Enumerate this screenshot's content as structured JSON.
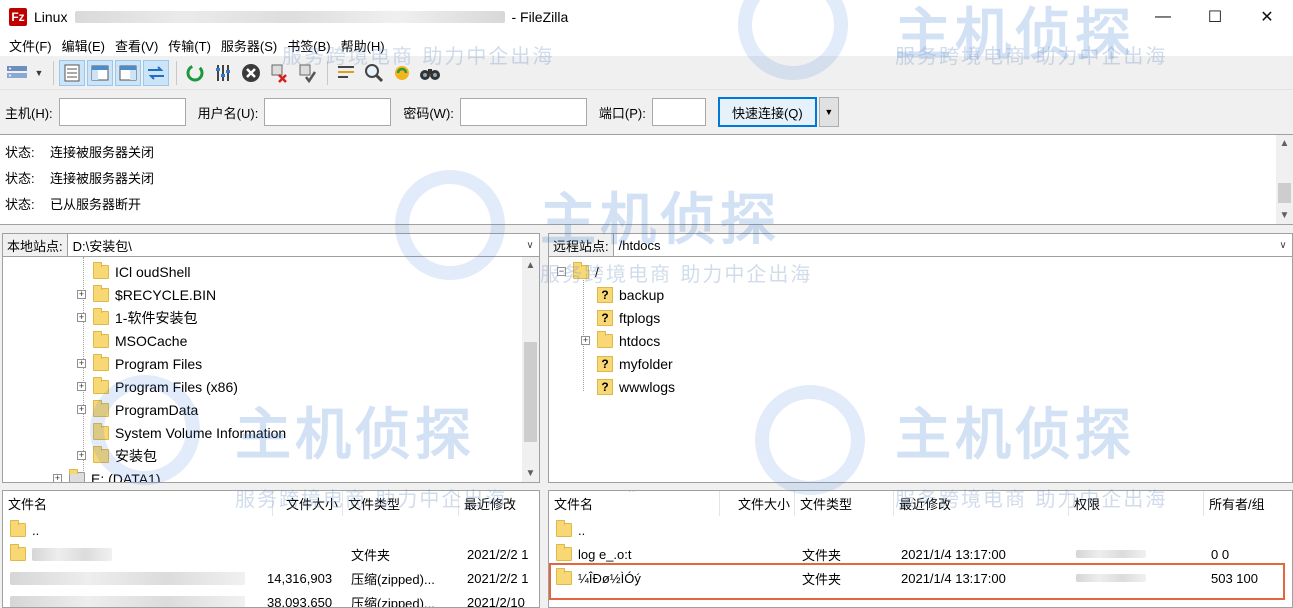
{
  "window": {
    "title_left": "Linux",
    "title_app": "- FileZilla",
    "icon_letter": "Fz",
    "minimize": "—",
    "maximize": "☐",
    "close": "✕"
  },
  "menu": [
    "文件(F)",
    "编辑(E)",
    "查看(V)",
    "传输(T)",
    "服务器(S)",
    "书签(B)",
    "帮助(H)"
  ],
  "toolbar_icons": [
    "site-manager-icon",
    "dropdown-caret-icon",
    "toggle-message-log-icon",
    "toggle-local-tree-icon",
    "toggle-remote-tree-icon",
    "toggle-transfer-queue-icon",
    "refresh-icon",
    "filter-icon",
    "cancel-icon",
    "disconnect-icon",
    "reconnect-icon",
    "directory-compare-icon",
    "search-icon",
    "sync-browse-icon",
    "find-files-icon"
  ],
  "quickconnect": {
    "host_label": "主机(H):",
    "user_label": "用户名(U):",
    "pass_label": "密码(W):",
    "port_label": "端口(P):",
    "host_value": "",
    "user_value": "",
    "pass_value": "",
    "port_value": "",
    "connect_label": "快速连接(Q)"
  },
  "log": [
    {
      "label": "状态:",
      "text": "连接被服务器关闭"
    },
    {
      "label": "状态:",
      "text": "连接被服务器关闭"
    },
    {
      "label": "状态:",
      "text": "已从服务器断开"
    }
  ],
  "local_site": {
    "label": "本地站点:",
    "path": "D:\\安装包\\"
  },
  "remote_site": {
    "label": "远程站点:",
    "path": "/htdocs"
  },
  "local_tree": [
    {
      "name": "ICl oudShell",
      "expander": ""
    },
    {
      "name": "$RECYCLE.BIN",
      "expander": "+"
    },
    {
      "name": "1-软件安装包",
      "expander": "+"
    },
    {
      "name": "MSOCache",
      "expander": ""
    },
    {
      "name": "Program Files",
      "expander": "+"
    },
    {
      "name": "Program Files (x86)",
      "expander": "+"
    },
    {
      "name": "ProgramData",
      "expander": "+"
    },
    {
      "name": "System Volume Information",
      "expander": ""
    },
    {
      "name": "安装包",
      "expander": "+"
    },
    {
      "name": "E: (DATA1)",
      "expander": "+"
    }
  ],
  "remote_tree": {
    "root": "/",
    "children": [
      {
        "name": "backup",
        "unknown": true,
        "expander": ""
      },
      {
        "name": "ftplogs",
        "unknown": true,
        "expander": ""
      },
      {
        "name": "htdocs",
        "unknown": false,
        "expander": "+"
      },
      {
        "name": "myfolder",
        "unknown": true,
        "expander": ""
      },
      {
        "name": "wwwlogs",
        "unknown": true,
        "expander": ""
      }
    ]
  },
  "local_files": {
    "headers": [
      "文件名",
      "文件大小",
      "文件类型",
      "最近修改"
    ],
    "rows": [
      {
        "name": "..",
        "size": "",
        "type": "",
        "modified": ""
      },
      {
        "name": "",
        "size": "",
        "type": "文件夹",
        "modified": "2021/2/2 1"
      },
      {
        "name": "",
        "size": "14,316,903",
        "type": "压缩(zipped)...",
        "modified": "2021/2/2 1"
      },
      {
        "name": "",
        "size": "38,093,650",
        "type": "压缩(zipped)...",
        "modified": "2021/2/10"
      }
    ]
  },
  "remote_files": {
    "headers": [
      "文件名",
      "文件大小",
      "文件类型",
      "最近修改",
      "权限",
      "所有者/组"
    ],
    "rows": [
      {
        "name": "..",
        "size": "",
        "type": "",
        "modified": "",
        "perms": "",
        "owner": ""
      },
      {
        "name": "log e_.o:t",
        "size": "",
        "type": "文件夹",
        "modified": "2021/1/4 13:17:00",
        "perms": "",
        "owner": "0 0"
      },
      {
        "name": "¼ÎÐø½ÌÓý",
        "size": "",
        "type": "文件夹",
        "modified": "2021/1/4 13:17:00",
        "perms": "",
        "owner": "503 100"
      }
    ]
  },
  "watermark": {
    "brand": "主机侦探",
    "slogan": "服务跨境电商 助力中企出海"
  },
  "colors": {
    "accent": "#0078d7",
    "highlight_box": "#e2673f",
    "folder": "#f8d775",
    "app_icon": "#bf0000"
  }
}
